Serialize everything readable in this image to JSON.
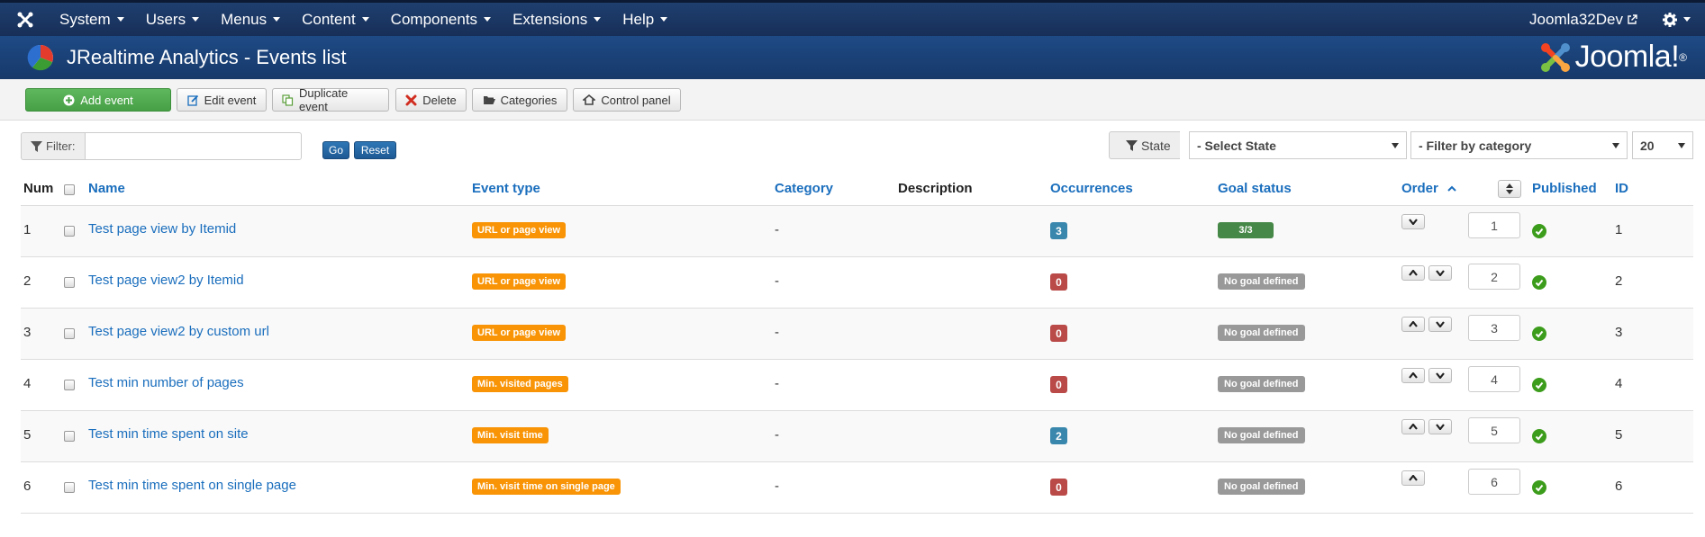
{
  "topnav": {
    "menu": [
      "System",
      "Users",
      "Menus",
      "Content",
      "Components",
      "Extensions",
      "Help"
    ],
    "site_name": "Joomla32Dev"
  },
  "header": {
    "title": "JRealtime Analytics - Events list",
    "brand": "Joomla!",
    "brand_mark": "®"
  },
  "toolbar": {
    "add": "Add event",
    "edit": "Edit event",
    "duplicate": "Duplicate event",
    "delete": "Delete",
    "categories": "Categories",
    "control_panel": "Control panel"
  },
  "filter": {
    "label": "Filter:",
    "value": "",
    "go": "Go",
    "reset": "Reset"
  },
  "state_filter": {
    "label": "State",
    "selected": "- Select State"
  },
  "category_filter": {
    "selected": "- Filter by category"
  },
  "limit": {
    "selected": "20"
  },
  "columns": {
    "num": "Num",
    "name": "Name",
    "event_type": "Event type",
    "category": "Category",
    "description": "Description",
    "occurrences": "Occurrences",
    "goal_status": "Goal status",
    "order": "Order",
    "published": "Published",
    "id": "ID"
  },
  "rows": [
    {
      "num": "1",
      "name": "Test page view by Itemid",
      "type": "URL or page view",
      "category": "-",
      "description": "",
      "occurrences": "3",
      "occ_color": "blue",
      "goal": "3/3",
      "goal_kind": "ok",
      "up": false,
      "down": true,
      "order": "1",
      "id": "1"
    },
    {
      "num": "2",
      "name": "Test page view2 by Itemid",
      "type": "URL or page view",
      "category": "-",
      "description": "",
      "occurrences": "0",
      "occ_color": "red",
      "goal": "No goal defined",
      "goal_kind": "none",
      "up": true,
      "down": true,
      "order": "2",
      "id": "2"
    },
    {
      "num": "3",
      "name": "Test page view2 by custom url",
      "type": "URL or page view",
      "category": "-",
      "description": "",
      "occurrences": "0",
      "occ_color": "red",
      "goal": "No goal defined",
      "goal_kind": "none",
      "up": true,
      "down": true,
      "order": "3",
      "id": "3"
    },
    {
      "num": "4",
      "name": "Test min number of pages",
      "type": "Min. visited pages",
      "category": "-",
      "description": "",
      "occurrences": "0",
      "occ_color": "red",
      "goal": "No goal defined",
      "goal_kind": "none",
      "up": true,
      "down": true,
      "order": "4",
      "id": "4"
    },
    {
      "num": "5",
      "name": "Test min time spent on site",
      "type": "Min. visit time",
      "category": "-",
      "description": "",
      "occurrences": "2",
      "occ_color": "blue",
      "goal": "No goal defined",
      "goal_kind": "none",
      "up": true,
      "down": true,
      "order": "5",
      "id": "5"
    },
    {
      "num": "6",
      "name": "Test min time spent on single page",
      "type": "Min. visit time on single page",
      "category": "-",
      "description": "",
      "occurrences": "0",
      "occ_color": "red",
      "goal": "No goal defined",
      "goal_kind": "none",
      "up": true,
      "down": false,
      "order": "6",
      "id": "6"
    }
  ],
  "colors": {
    "nav_bg": "#1a3867",
    "header_bg": "#1e4a85",
    "link": "#1a6ebd",
    "type_badge": "#f89406",
    "occ_blue": "#3a87ad",
    "occ_red": "#b94a48",
    "goal_ok": "#468847",
    "goal_none": "#999999",
    "add_button": "#51a351"
  }
}
